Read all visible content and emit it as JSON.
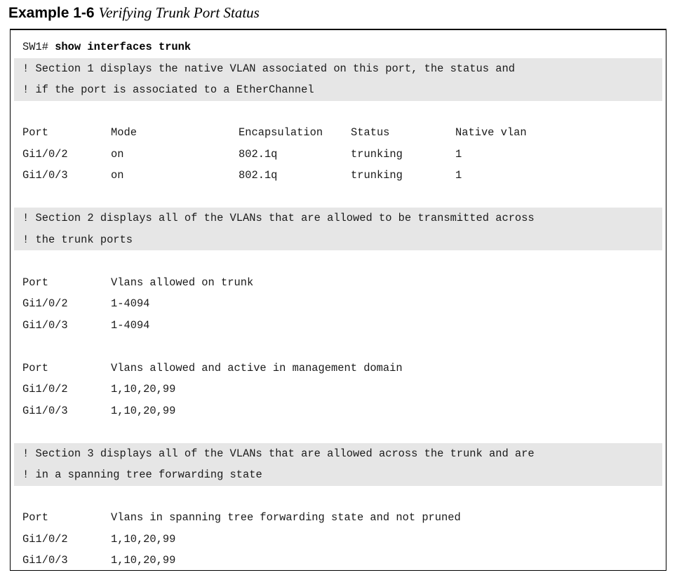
{
  "caption": {
    "label": "Example 1-6",
    "title": "Verifying Trunk Port Status"
  },
  "command": {
    "prompt": "SW1# ",
    "text": "show interfaces trunk"
  },
  "comments": {
    "section1_line1": "! Section 1 displays the native VLAN associated on this port, the status and",
    "section1_line2": "! if the port is associated to a EtherChannel",
    "section2_line1": "! Section 2 displays all of the VLANs that are allowed to be transmitted across",
    "section2_line2": "! the trunk ports",
    "section3_line1": "! Section 3 displays all of the VLANs that are allowed across the trunk and are",
    "section3_line2": "! in a spanning tree forwarding state"
  },
  "table1": {
    "headers": [
      "Port",
      "Mode",
      "Encapsulation",
      "Status",
      "Native vlan"
    ],
    "rows": [
      [
        "Gi1/0/2",
        "on",
        "802.1q",
        "trunking",
        "1"
      ],
      [
        "Gi1/0/3",
        "on",
        "802.1q",
        "trunking",
        "1"
      ]
    ]
  },
  "table2": {
    "headers": [
      "Port",
      "Vlans allowed on trunk"
    ],
    "rows": [
      [
        "Gi1/0/2",
        "1-4094"
      ],
      [
        "Gi1/0/3",
        "1-4094"
      ]
    ]
  },
  "table3": {
    "headers": [
      "Port",
      "Vlans allowed and active in management domain"
    ],
    "rows": [
      [
        "Gi1/0/2",
        "1,10,20,99"
      ],
      [
        "Gi1/0/3",
        "1,10,20,99"
      ]
    ]
  },
  "table4": {
    "headers": [
      "Port",
      "Vlans in spanning tree forwarding state and not pruned"
    ],
    "rows": [
      [
        "Gi1/0/2",
        "1,10,20,99"
      ],
      [
        "Gi1/0/3",
        "1,10,20,99"
      ]
    ]
  }
}
